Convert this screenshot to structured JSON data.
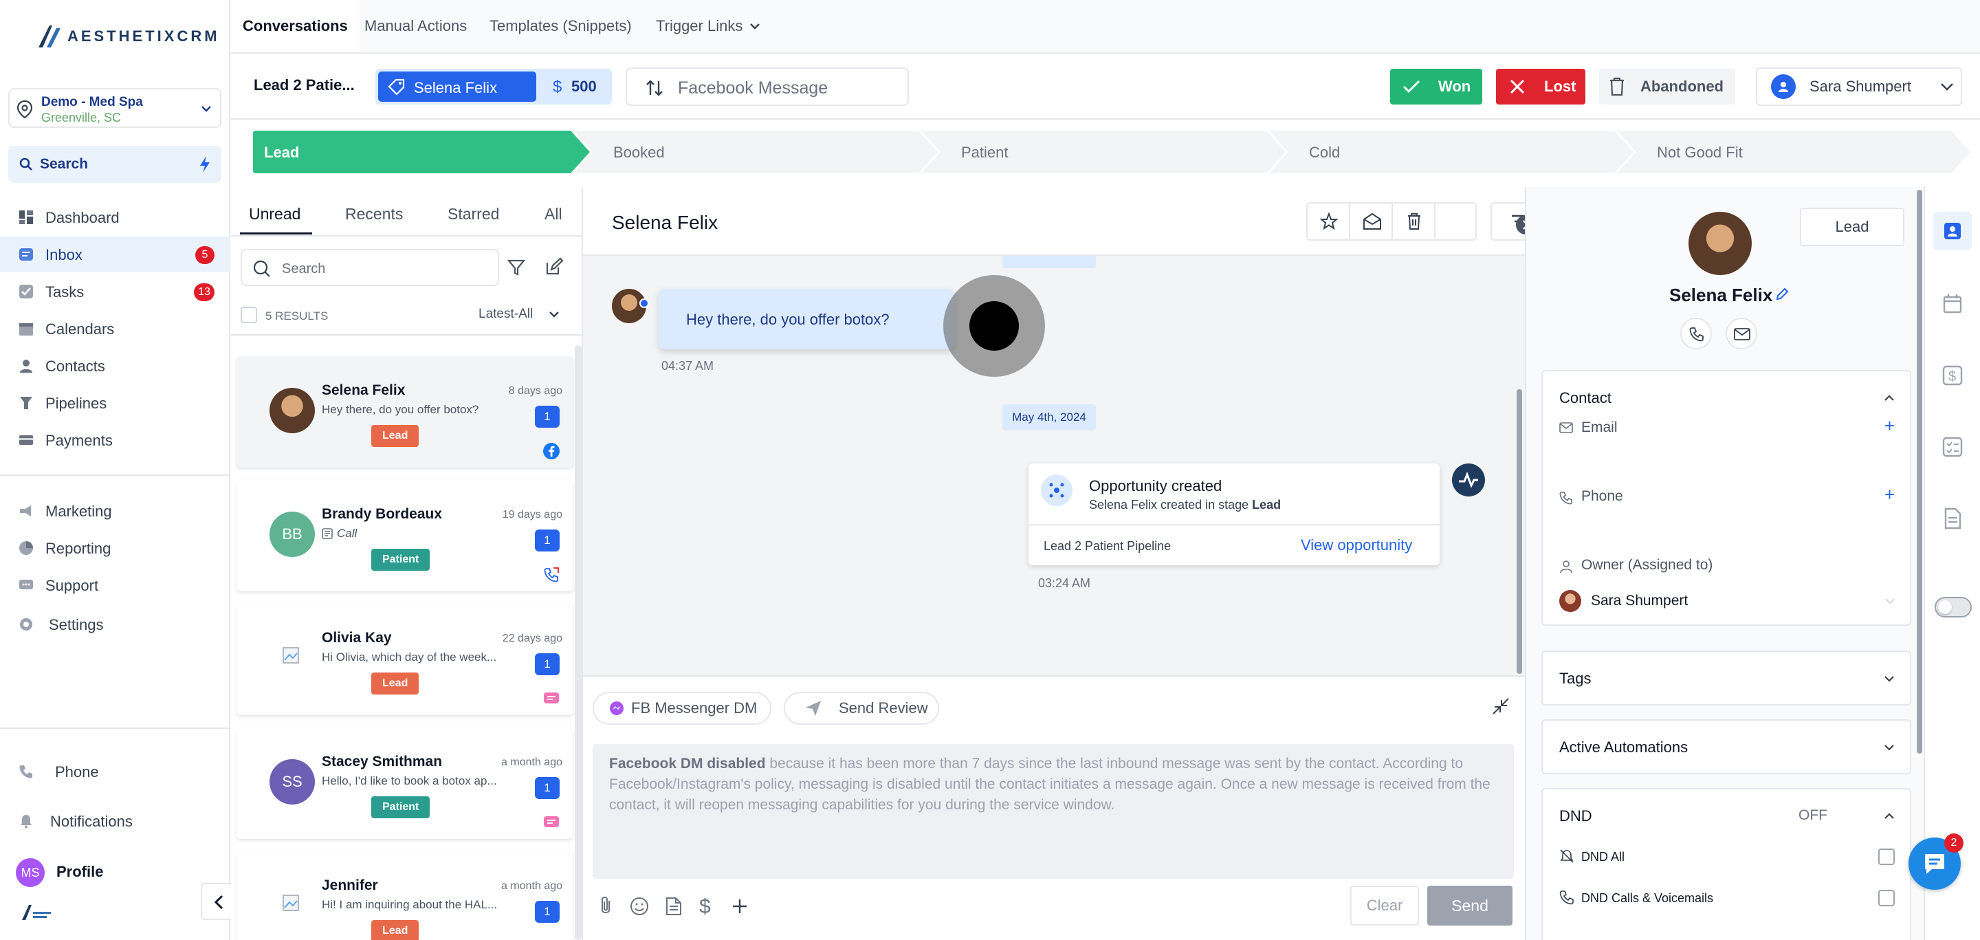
{
  "brand": {
    "logo_text": "AESTHETIXCRM"
  },
  "location": {
    "name": "Demo - Med Spa",
    "city": "Greenville, SC"
  },
  "search": {
    "label": "Search"
  },
  "sidebar": {
    "items": [
      {
        "label": "Dashboard"
      },
      {
        "label": "Inbox",
        "badge": "5"
      },
      {
        "label": "Tasks",
        "badge": "13"
      },
      {
        "label": "Calendars"
      },
      {
        "label": "Contacts"
      },
      {
        "label": "Pipelines"
      },
      {
        "label": "Payments"
      },
      {
        "label": "Marketing"
      },
      {
        "label": "Reporting"
      },
      {
        "label": "Support"
      },
      {
        "label": "Settings"
      }
    ],
    "bottom": {
      "phone": "Phone",
      "notifications": "Notifications",
      "profile": "Profile",
      "profile_initials": "MS"
    }
  },
  "topnav": {
    "tabs": [
      "Conversations",
      "Manual Actions",
      "Templates (Snippets)",
      "Trigger Links"
    ]
  },
  "opportunity": {
    "title": "Lead 2 Patie...",
    "contact_tag": "Selena Felix",
    "value": "500",
    "source": "Facebook Message",
    "won": "Won",
    "lost": "Lost",
    "abandoned": "Abandoned",
    "owner": "Sara Shumpert"
  },
  "stages": [
    "Lead",
    "Booked",
    "Patient",
    "Cold",
    "Not Good Fit"
  ],
  "conv_list": {
    "tabs": [
      "Unread",
      "Recents",
      "Starred",
      "All"
    ],
    "search_placeholder": "Search",
    "results": "5 RESULTS",
    "sort": "Latest-All",
    "items": [
      {
        "name": "Selena Felix",
        "preview": "Hey there, do you offer botox?",
        "time": "8 days ago",
        "count": "1",
        "tag": "Lead"
      },
      {
        "name": "Brandy Bordeaux",
        "initials": "BB",
        "preview": "Call",
        "time": "19 days ago",
        "count": "1",
        "tag": "Patient"
      },
      {
        "name": "Olivia Kay",
        "preview": "Hi Olivia, which day of the week...",
        "time": "22 days ago",
        "count": "1",
        "tag": "Lead"
      },
      {
        "name": "Stacey Smithman",
        "initials": "SS",
        "preview": "Hello, I'd like to book a botox ap...",
        "time": "a month ago",
        "count": "1",
        "tag": "Patient"
      },
      {
        "name": "Jennifer",
        "preview": "Hi! I am inquiring about the HAL...",
        "time": "a month ago",
        "count": "1",
        "tag": "Lead"
      }
    ]
  },
  "chat": {
    "contact_name": "Selena Felix",
    "message": "Hey there, do you offer botox?",
    "message_time": "04:37 AM",
    "date_divider": "May 4th, 2024",
    "opp_card": {
      "title": "Opportunity created",
      "subtitle_prefix": "Selena Felix created in stage ",
      "subtitle_stage": "Lead",
      "pipeline": "Lead 2 Patient Pipeline",
      "link": "View opportunity",
      "time": "03:24 AM"
    },
    "composer": {
      "channel": "FB Messenger DM",
      "review": "Send Review",
      "disabled_bold": "Facebook DM disabled",
      "disabled_text": " because it has been more than 7 days since the last inbound message was sent by the contact. According to Facebook/Instagram's policy, messaging is disabled until the contact initiates a message again. Once a new message is received from the contact, it will reopen messaging capabilities for you during the service window.",
      "clear": "Clear",
      "send": "Send"
    }
  },
  "contact_panel": {
    "stage_button": "Lead",
    "name": "Selena Felix",
    "contact_section": "Contact",
    "email_label": "Email",
    "phone_label": "Phone",
    "owner_label": "Owner (Assigned to)",
    "owner_value": "Sara Shumpert",
    "tags": "Tags",
    "automations": "Active Automations",
    "dnd": "DND",
    "dnd_state": "OFF",
    "dnd_all": "DND All",
    "dnd_calls": "DND Calls & Voicemails"
  },
  "chat_widget": {
    "badge": "2"
  },
  "colors": {
    "accent": "#2563eb",
    "won": "#22b573",
    "lost": "#e0242f",
    "lead_stage": "#2fbf84",
    "lead_tag": "#e8684a",
    "patient_tag": "#2a9d8f"
  }
}
